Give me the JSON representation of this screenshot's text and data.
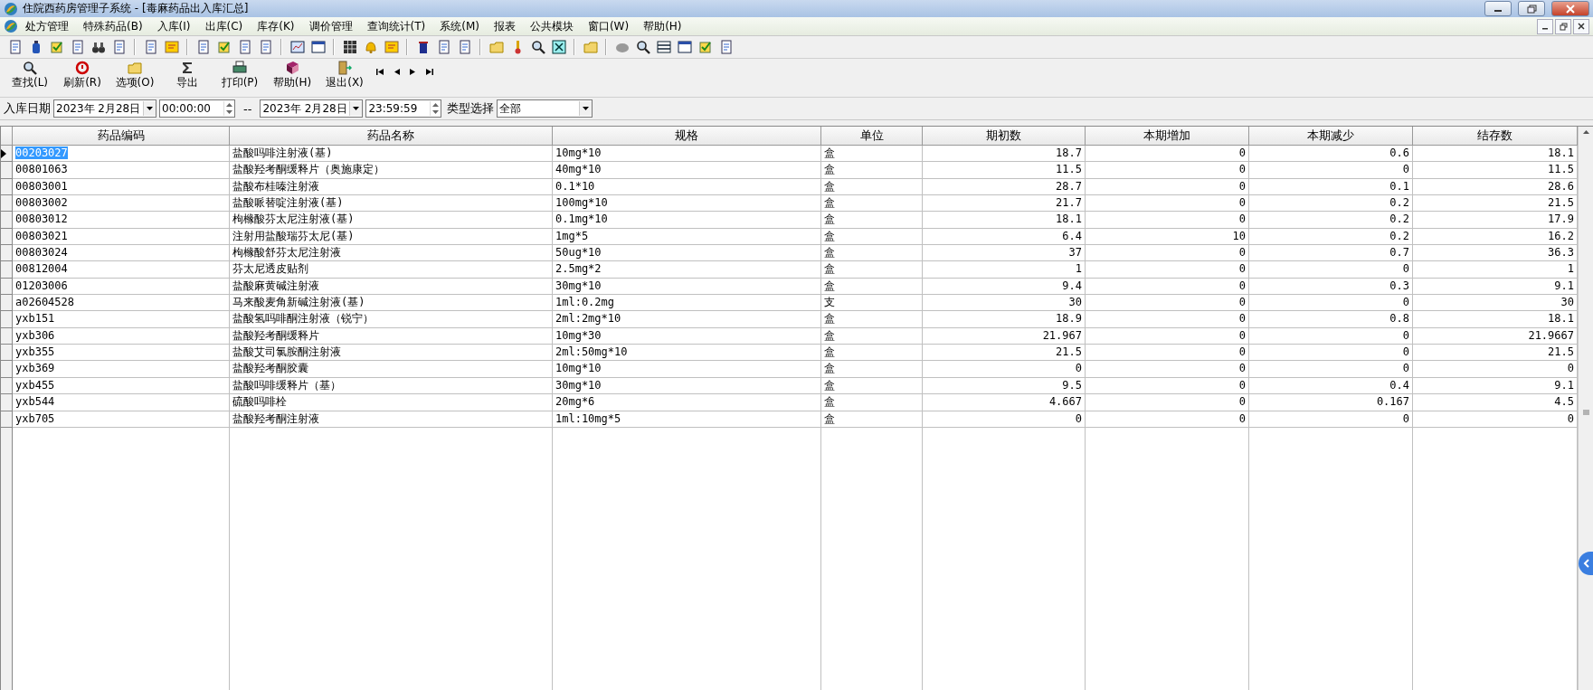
{
  "window": {
    "title": "住院西药房管理子系统 - [毒麻药品出入库汇总]"
  },
  "menu": [
    {
      "label": "处方管理"
    },
    {
      "label": "特殊药品(B)"
    },
    {
      "label": "入库(I)"
    },
    {
      "label": "出库(C)"
    },
    {
      "label": "库存(K)"
    },
    {
      "label": "调价管理"
    },
    {
      "label": "查询统计(T)"
    },
    {
      "label": "系统(M)"
    },
    {
      "label": "报表"
    },
    {
      "label": "公共模块"
    },
    {
      "label": "窗口(W)"
    },
    {
      "label": "帮助(H)"
    }
  ],
  "actions": [
    {
      "label": "查找(L)"
    },
    {
      "label": "刷新(R)"
    },
    {
      "label": "选项(O)"
    },
    {
      "label": "导出"
    },
    {
      "label": "打印(P)"
    },
    {
      "label": "帮助(H)"
    },
    {
      "label": "退出(X)"
    }
  ],
  "filter": {
    "date_label": "入库日期",
    "start_date": "2023年 2月28日",
    "start_time": "00:00:00",
    "separator": "--",
    "end_date": "2023年 2月28日",
    "end_time": "23:59:59",
    "type_label": "类型选择",
    "type_value": "全部"
  },
  "table": {
    "columns": [
      "药品编码",
      "药品名称",
      "规格",
      "单位",
      "期初数",
      "本期增加",
      "本期减少",
      "结存数"
    ],
    "rows": [
      {
        "selected": true,
        "cells": [
          "00203027",
          "盐酸吗啡注射液(基)",
          "10mg*10",
          "盒",
          "18.7",
          "0",
          "0.6",
          "18.1"
        ]
      },
      {
        "selected": false,
        "cells": [
          "00801063",
          "盐酸羟考酮缓释片（奥施康定）",
          "40mg*10",
          "盒",
          "11.5",
          "0",
          "0",
          "11.5"
        ]
      },
      {
        "selected": false,
        "cells": [
          "00803001",
          "盐酸布桂嗪注射液",
          "0.1*10",
          "盒",
          "28.7",
          "0",
          "0.1",
          "28.6"
        ]
      },
      {
        "selected": false,
        "cells": [
          "00803002",
          "盐酸哌替啶注射液(基)",
          "100mg*10",
          "盒",
          "21.7",
          "0",
          "0.2",
          "21.5"
        ]
      },
      {
        "selected": false,
        "cells": [
          "00803012",
          "枸橼酸芬太尼注射液(基)",
          "0.1mg*10",
          "盒",
          "18.1",
          "0",
          "0.2",
          "17.9"
        ]
      },
      {
        "selected": false,
        "cells": [
          "00803021",
          "注射用盐酸瑞芬太尼(基)",
          "1mg*5",
          "盒",
          "6.4",
          "10",
          "0.2",
          "16.2"
        ]
      },
      {
        "selected": false,
        "cells": [
          "00803024",
          "枸橼酸舒芬太尼注射液",
          "50ug*10",
          "盒",
          "37",
          "0",
          "0.7",
          "36.3"
        ]
      },
      {
        "selected": false,
        "cells": [
          "00812004",
          "芬太尼透皮贴剂",
          "2.5mg*2",
          "盒",
          "1",
          "0",
          "0",
          "1"
        ]
      },
      {
        "selected": false,
        "cells": [
          "01203006",
          "盐酸麻黄碱注射液",
          "30mg*10",
          "盒",
          "9.4",
          "0",
          "0.3",
          "9.1"
        ]
      },
      {
        "selected": false,
        "cells": [
          "a02604528",
          "马来酸麦角新碱注射液(基)",
          "1ml:0.2mg",
          "支",
          "30",
          "0",
          "0",
          "30"
        ]
      },
      {
        "selected": false,
        "cells": [
          "yxb151",
          "盐酸氢吗啡酮注射液（锐宁）",
          "2ml:2mg*10",
          "盒",
          "18.9",
          "0",
          "0.8",
          "18.1"
        ]
      },
      {
        "selected": false,
        "cells": [
          "yxb306",
          "盐酸羟考酮缓释片",
          "10mg*30",
          "盒",
          "21.967",
          "0",
          "0",
          "21.9667"
        ]
      },
      {
        "selected": false,
        "cells": [
          "yxb355",
          "盐酸艾司氯胺酮注射液",
          "2ml:50mg*10",
          "盒",
          "21.5",
          "0",
          "0",
          "21.5"
        ]
      },
      {
        "selected": false,
        "cells": [
          "yxb369",
          "盐酸羟考酮胶囊",
          "10mg*10",
          "盒",
          "0",
          "0",
          "0",
          "0"
        ]
      },
      {
        "selected": false,
        "cells": [
          "yxb455",
          "盐酸吗啡缓释片（基）",
          "30mg*10",
          "盒",
          "9.5",
          "0",
          "0.4",
          "9.1"
        ]
      },
      {
        "selected": false,
        "cells": [
          "yxb544",
          "硫酸吗啡栓",
          "20mg*6",
          "盒",
          "4.667",
          "0",
          "0.167",
          "4.5"
        ]
      },
      {
        "selected": false,
        "cells": [
          "yxb705",
          "盐酸羟考酮注射液",
          "1ml:10mg*5",
          "盒",
          "0",
          "0",
          "0",
          "0"
        ]
      }
    ]
  }
}
